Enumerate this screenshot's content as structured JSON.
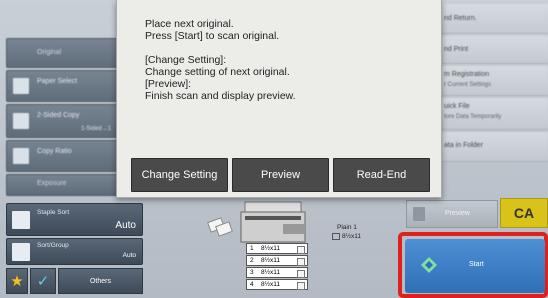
{
  "modal": {
    "message_lines": [
      "Place next original.",
      "Press [Start] to scan original.",
      "",
      "[Change Setting]:",
      "Change setting of next original.",
      "[Preview]:",
      "Finish scan and display preview."
    ],
    "buttons": {
      "change_setting": "Change Setting",
      "preview": "Preview",
      "read_end": "Read-End"
    }
  },
  "left_panel": {
    "original": "Original",
    "paper_select": "Paper Select",
    "two_sided_copy": "2-Sided Copy",
    "two_sided_value": "1-Sided→1",
    "copy_ratio": "Copy Ratio",
    "exposure": "Exposure",
    "staple_sort": {
      "label": "Staple Sort",
      "value": "Auto"
    },
    "sort_group": {
      "label": "Sort/Group",
      "value": "Auto"
    },
    "others": "Others"
  },
  "right_panel": {
    "send_return": "nd Return.",
    "send_print": "nd Print",
    "program_registration": "m Registration",
    "current_settings": "r Current Settings",
    "quick_file": "uick File",
    "store_data": "tore Data Temporarily",
    "data_in_folder": "ata in Folder",
    "preview": "Preview",
    "ca": "CA",
    "start": "Start"
  },
  "device": {
    "tray_label": "Plain 1",
    "tray_size": "8½x11",
    "paper_trays": [
      {
        "num": "1",
        "size": "8½x11"
      },
      {
        "num": "2",
        "size": "8½x11"
      },
      {
        "num": "3",
        "size": "8½x11"
      },
      {
        "num": "4",
        "size": "8½x11"
      }
    ]
  },
  "colors": {
    "modal_button": "#4a4a4a",
    "start_button": "#2f6fb6",
    "start_highlight": "#e0201c",
    "ca_button": "#d9c21a"
  }
}
